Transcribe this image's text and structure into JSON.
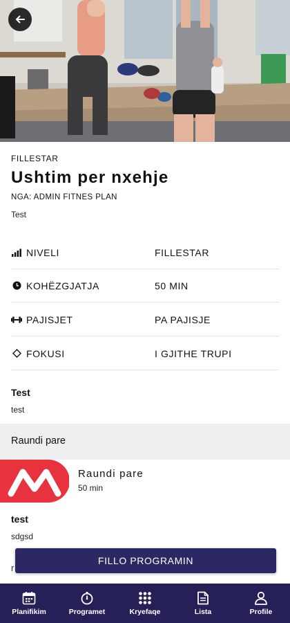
{
  "hero": {
    "image": "gym-workout-photo",
    "back_icon": "arrow-left-icon"
  },
  "workout": {
    "level_tag": "FILLESTAR",
    "title": "Ushtim per nxehje",
    "author": "NGA: ADMIN FITNES PLAN",
    "description": "Test"
  },
  "details": [
    {
      "icon": "signal-bars-icon",
      "label": "NIVELI",
      "value": "FILLESTAR"
    },
    {
      "icon": "clock-icon",
      "label": "KOHËZGJATJA",
      "value": "50 MIN"
    },
    {
      "icon": "dumbbell-icon",
      "label": "PAJISJET",
      "value": "PA PAJISJE"
    },
    {
      "icon": "diamond-icon",
      "label": "FOKUSI",
      "value": "I GJITHE TRUPI"
    }
  ],
  "notes": {
    "title": "Test",
    "text": "test"
  },
  "round_section": {
    "header": "Raundi pare"
  },
  "round_card": {
    "name": "Raundi pare",
    "duration": "50 min",
    "logo_color": "#e8333f"
  },
  "extra_section": {
    "title": "test",
    "text": "sdgsd",
    "peek": "r"
  },
  "start_button": {
    "label": "FILLO PROGRAMIN"
  },
  "tabbar": {
    "bg_color": "#252158",
    "items": [
      {
        "icon": "calendar-icon",
        "label": "Planifikim"
      },
      {
        "icon": "stopwatch-icon",
        "label": "Programet"
      },
      {
        "icon": "grid-icon",
        "label": "Kryefaqe"
      },
      {
        "icon": "document-icon",
        "label": "Lista"
      },
      {
        "icon": "user-icon",
        "label": "Profile"
      }
    ]
  }
}
